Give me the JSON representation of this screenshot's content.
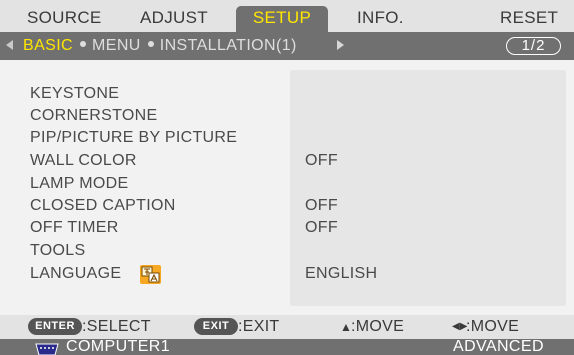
{
  "tabs": [
    {
      "label": "SOURCE"
    },
    {
      "label": "ADJUST"
    },
    {
      "label": "SETUP",
      "active": true
    },
    {
      "label": "INFO."
    },
    {
      "label": "RESET"
    }
  ],
  "subtabs": {
    "items": [
      "BASIC",
      "MENU",
      "INSTALLATION(1)"
    ],
    "active": "BASIC",
    "page": "1/2"
  },
  "menu": {
    "items": [
      {
        "label": "KEYSTONE",
        "value": ""
      },
      {
        "label": "CORNERSTONE",
        "value": ""
      },
      {
        "label": "PIP/PICTURE BY PICTURE",
        "value": ""
      },
      {
        "label": "WALL COLOR",
        "value": "OFF"
      },
      {
        "label": "LAMP MODE",
        "value": ""
      },
      {
        "label": "CLOSED CAPTION",
        "value": "OFF"
      },
      {
        "label": "OFF TIMER",
        "value": "OFF"
      },
      {
        "label": "TOOLS",
        "value": ""
      },
      {
        "label": "LANGUAGE",
        "value": "ENGLISH",
        "icon": "language-icon"
      }
    ]
  },
  "hints": {
    "enter_key": "ENTER",
    "select": ":SELECT",
    "exit_key": "EXIT",
    "exit": ":EXIT",
    "move_vertical": ":MOVE",
    "move_horizontal": ":MOVE"
  },
  "status": {
    "source": "COMPUTER1",
    "mode": "ADVANCED"
  },
  "colors": {
    "accent": "#ffe600",
    "tab_active_bg": "#707070",
    "bar_bg": "#e3e3e3",
    "panel_bg": "#f2f2f2",
    "value_panel_bg": "#e6e6e6",
    "icon_orange": "#f7a823"
  }
}
